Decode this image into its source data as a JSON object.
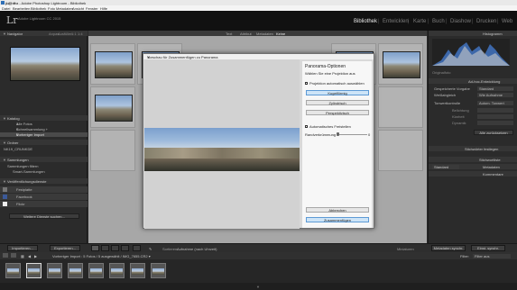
{
  "titlebar": {
    "title": "jkamera - Adobe Photoshop Lightroom - Bibliothek",
    "controls": "–  ▢  ✕"
  },
  "menubar": [
    "Datei",
    "Bearbeiten",
    "Bibliothek",
    "Foto",
    "Metadaten",
    "Ansicht",
    "Fenster",
    "Hilfe"
  ],
  "modules": {
    "logo": "Lr",
    "catalog": "Adobe Lightroom CC 2015",
    "items": [
      "Bibliothek",
      "Entwicklen",
      "Karte",
      "Buch",
      "Diashow",
      "Drucken",
      "Web"
    ],
    "active": "Bibliothek"
  },
  "left_panel": {
    "navigator_header": "Navigator",
    "navigator_modes": [
      "Anpas.",
      "Ausfüllen",
      "1:1",
      "1:4"
    ],
    "catalog_header": "Katalog",
    "catalog_items": [
      {
        "label": "Alle Fotos",
        "count": "1"
      },
      {
        "label": "Schnellsammlung +",
        "count": "0"
      },
      {
        "label": "Vorheriger Import",
        "count": "5"
      }
    ],
    "folders_header": "Ordner",
    "volume": "NK19_CRUNKDE",
    "collections_header": "Sammlungen",
    "collections_items": [
      "Sammlungen filtern",
      "Smart-Sammlungen"
    ],
    "publish_header": "Veröffentlichungsdienste",
    "publish_items": [
      "Festplatte",
      "Facebook",
      "Flickr"
    ],
    "publish_more": "Weitere Dienste suchen...",
    "import_button": "Importieren...",
    "export_button": "Exportieren..."
  },
  "center": {
    "filter_tabs": [
      "Text",
      "Attribut",
      "Metadaten",
      "Keine"
    ],
    "filter_active": "Keine"
  },
  "dialog": {
    "title": "Vorschau für Zusammenfügen zu Panorama",
    "close": "✕",
    "options_title": "Panorama-Optionen",
    "options_subtitle": "Wählen Sie eine Projektion aus",
    "auto_projection": "Projektion automatisch auswählen",
    "projections": [
      "Kugelförmig",
      "Zylindrisch",
      "Perspektivisch"
    ],
    "selected_projection": "Kugelförmig",
    "auto_crop": "Automatisches Freistellen",
    "boundary_warp": "Randverkrümmung",
    "boundary_value": "0",
    "cancel": "Abbrechen",
    "merge": "Zusammenfügen"
  },
  "right_panel": {
    "histogram": "Histogramm",
    "original": "Originalfoto",
    "quick_develop": "Ad-hoc-Entwicklung",
    "saved_preset": "Gespeicherte Vorgabe",
    "saved_preset_val": "Standard",
    "white_balance": "Weißabgleich",
    "white_balance_val": "Wie Aufnahme",
    "tone_control": "Tonwertkontrolle",
    "tone_btn": "Autom. Tonwert",
    "exposure": "Belichtung",
    "clarity": "Klarheit",
    "vibrance": "Dynamik",
    "reset": "Alle zurücksetzen",
    "keywords": "Stichwörter festlegen",
    "keyword_list": "Stichwortliste",
    "metadata_label": "Standard",
    "metadata": "Metadaten",
    "comments": "Kommentare",
    "sync_btn": "Metadaten synchr.",
    "sync_settings_btn": "Einst. synchr."
  },
  "toolbar": {
    "sort_label": "Sortieren:",
    "sort_value": "Aufnahme (nach Uhrzeit)",
    "thumbnails_label": "Miniaturen"
  },
  "filmbar": {
    "path": "Vorheriger Import : 5 Fotos / 5 ausgewählt / IMG_7655.CR2 ▾",
    "filter_label": "Filter:",
    "filter_value": "Filter aus"
  }
}
